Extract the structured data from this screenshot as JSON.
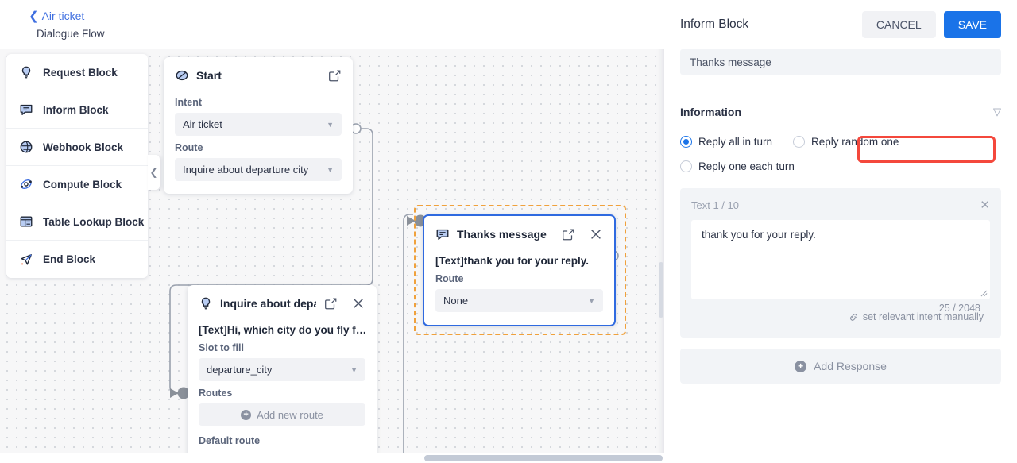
{
  "breadcrumb": {
    "back_label": "Air ticket",
    "back_icon": "chevron-left-icon",
    "subtitle": "Dialogue Flow"
  },
  "palette": {
    "items": [
      {
        "label": "Request Block",
        "icon": "lightbulb-icon"
      },
      {
        "label": "Inform Block",
        "icon": "speech-bubble-icon"
      },
      {
        "label": "Webhook Block",
        "icon": "globe-arrows-icon"
      },
      {
        "label": "Compute Block",
        "icon": "atom-icon"
      },
      {
        "label": "Table Lookup Block",
        "icon": "table-icon"
      },
      {
        "label": "End Block",
        "icon": "paper-plane-icon"
      }
    ],
    "collapse_icon": "chevron-left-icon"
  },
  "canvas": {
    "nodes": {
      "start": {
        "title": "Start",
        "icon": "start-icon",
        "edit_icon": "edit-square-icon",
        "intent_label": "Intent",
        "intent_value": "Air ticket",
        "route_label": "Route",
        "route_value": "Inquire about departure city"
      },
      "thanks": {
        "title": "Thanks message",
        "icon": "speech-bubble-icon",
        "edit_icon": "edit-square-icon",
        "close_icon": "close-icon",
        "text": "[Text]thank you for your reply.",
        "route_label": "Route",
        "route_value": "None"
      },
      "inquire": {
        "title": "Inquire about depa…",
        "icon": "lightbulb-icon",
        "edit_icon": "edit-square-icon",
        "close_icon": "close-icon",
        "text": "[Text]Hi, which city do you fly f…",
        "slot_label": "Slot to fill",
        "slot_value": "departure_city",
        "routes_label": "Routes",
        "add_route_label": "Add new route",
        "default_route_label": "Default route"
      }
    }
  },
  "panel": {
    "title": "Inform Block",
    "cancel_label": "CANCEL",
    "save_label": "SAVE",
    "name_value": "Thanks message",
    "section": {
      "title": "Information",
      "collapse_icon": "chevron-down-icon"
    },
    "radios": [
      {
        "label": "Reply all in turn",
        "selected": true
      },
      {
        "label": "Reply random one",
        "selected": false
      },
      {
        "label": "Reply one each turn",
        "selected": false
      }
    ],
    "response": {
      "label": "Text  1 / 10",
      "close_icon": "close-icon",
      "text_value": "thank you for your reply.",
      "char_count": "25 / 2048",
      "intent_link_label": "set relevant intent manually",
      "intent_link_icon": "link-chain-icon"
    },
    "add_response_label": "Add Response"
  },
  "colors": {
    "accent": "#1a73e8",
    "selection_outline": "#f0a13c",
    "highlight": "#f4483c",
    "node_border_selected": "#2f6ae0",
    "canvas_bg": "#f7f7f8"
  }
}
